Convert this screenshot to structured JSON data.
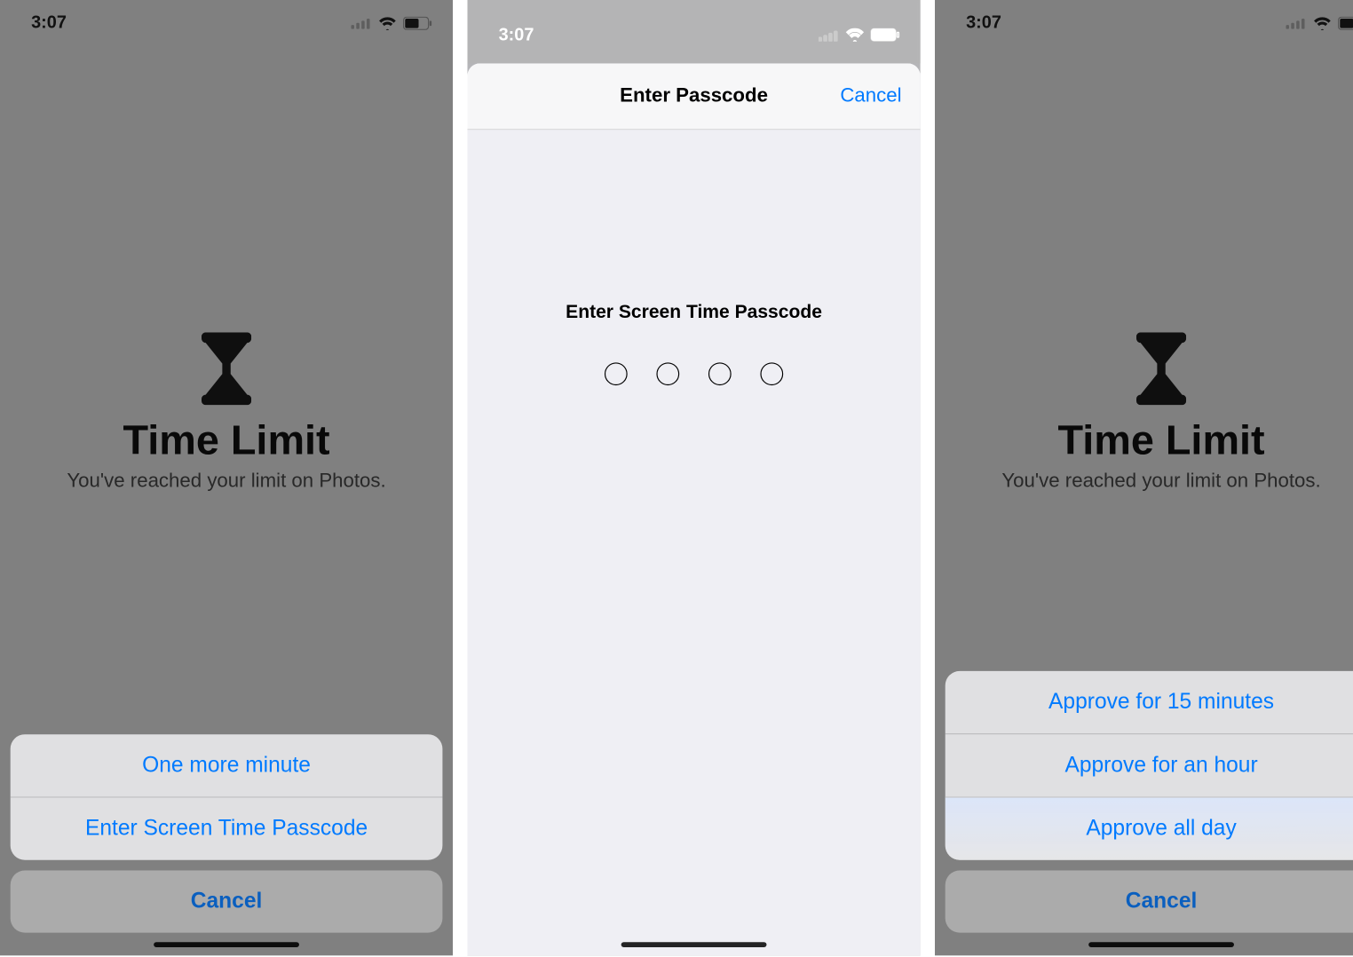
{
  "status": {
    "time": "3:07"
  },
  "time_limit": {
    "title": "Time Limit",
    "subtitle": "You've reached your limit on Photos."
  },
  "screen1": {
    "options": {
      "one_more_minute": "One more minute",
      "enter_passcode": "Enter Screen Time Passcode"
    },
    "cancel": "Cancel"
  },
  "screen2": {
    "header_title": "Enter Passcode",
    "cancel": "Cancel",
    "prompt": "Enter Screen Time Passcode"
  },
  "screen3": {
    "options": {
      "approve_15": "Approve for 15 minutes",
      "approve_hour": "Approve for an hour",
      "approve_day": "Approve all day"
    },
    "cancel": "Cancel"
  }
}
